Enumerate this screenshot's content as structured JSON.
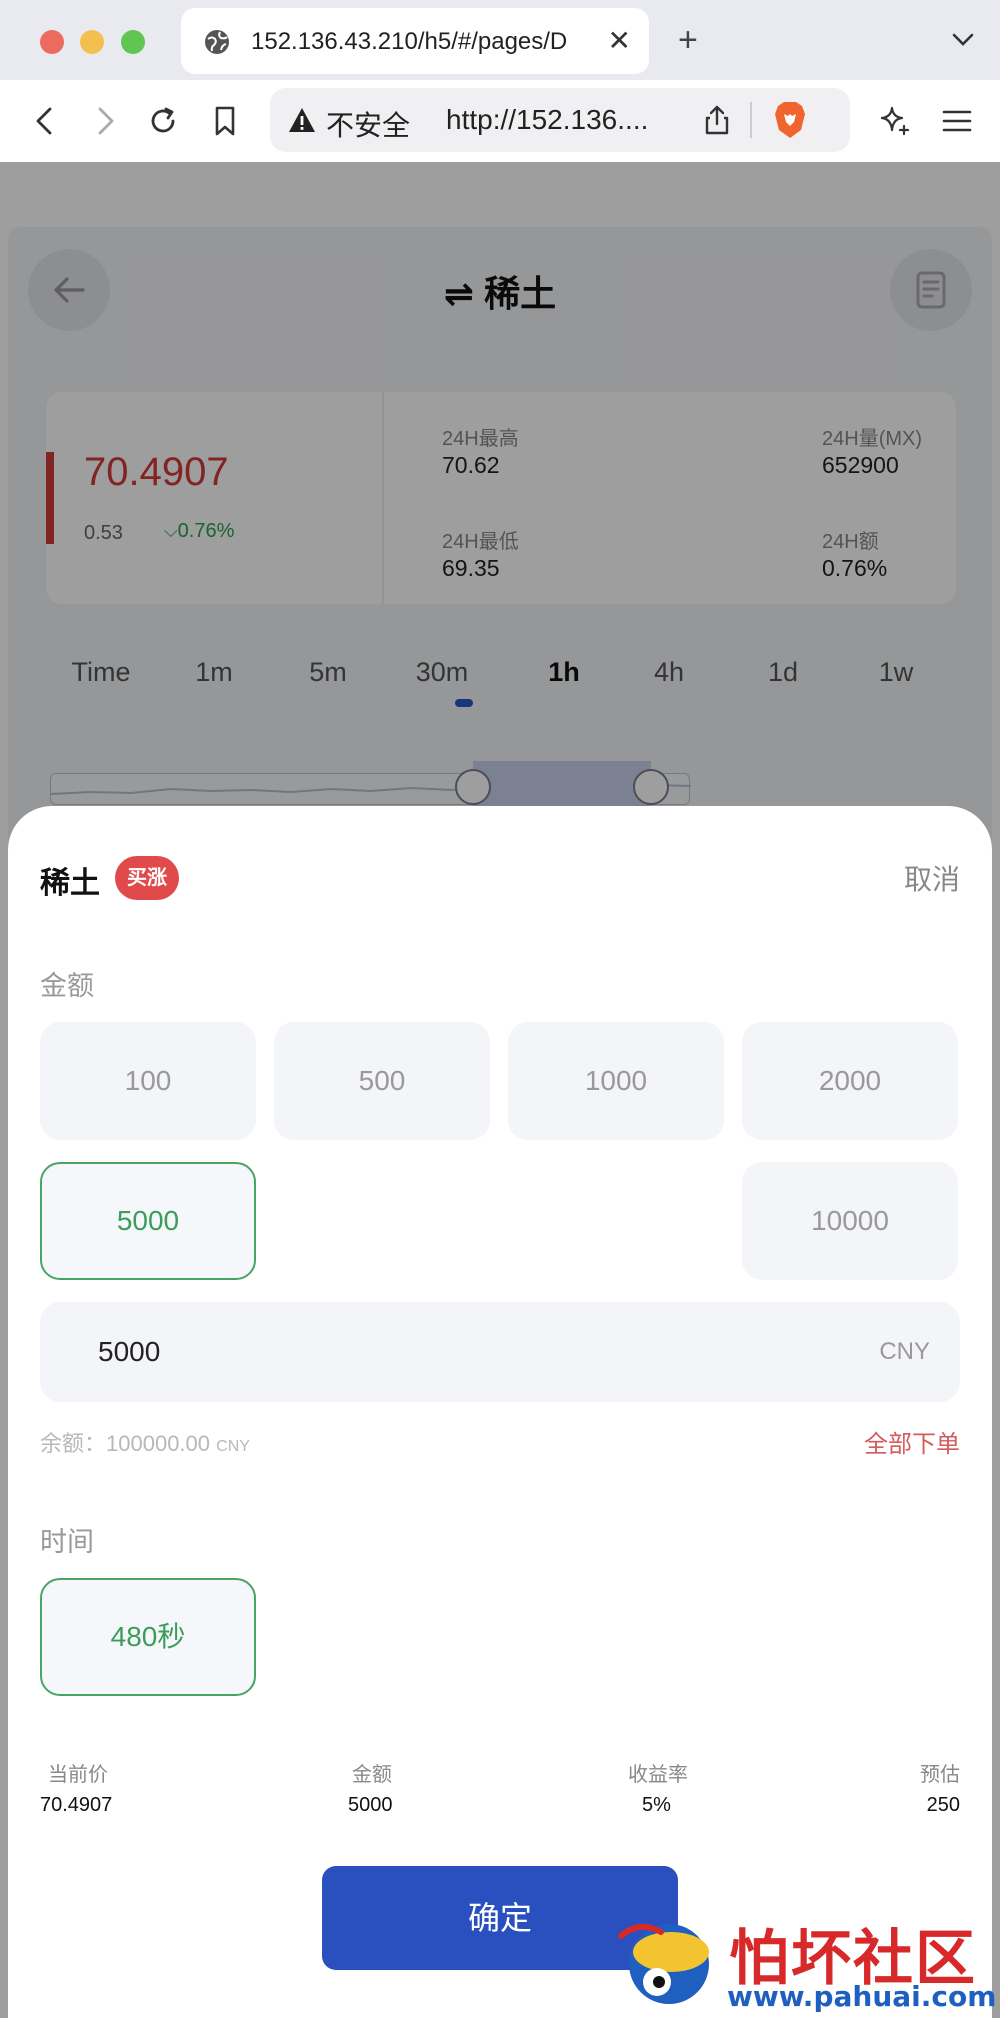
{
  "browser": {
    "tab_title": "152.136.43.210/h5/#/pages/D",
    "security_label": "不安全",
    "url_display": "http://152.136...."
  },
  "page": {
    "title": "⇌ 稀土",
    "price": "70.4907",
    "change_abs": "0.53",
    "change_pct": "0.76%",
    "stats": [
      {
        "label": "24H最高",
        "value": "70.62"
      },
      {
        "label": "24H量(MX)",
        "value": "652900"
      },
      {
        "label": "24H最低",
        "value": "69.35"
      },
      {
        "label": "24H额",
        "value": "0.76%"
      }
    ],
    "timeframes": [
      "Time",
      "1m",
      "5m",
      "30m",
      "1h",
      "4h",
      "1d",
      "1w"
    ],
    "active_timeframe": "1h"
  },
  "sheet": {
    "title": "稀土",
    "badge": "买涨",
    "cancel": "取消",
    "amount_label": "金额",
    "amounts": [
      "100",
      "500",
      "1000",
      "2000",
      "5000",
      "10000"
    ],
    "selected_amount": "5000",
    "input_value": "5000",
    "input_unit": "CNY",
    "balance_label": "余额：",
    "balance_value": "100000.00",
    "balance_unit": "CNY",
    "all_order": "全部下单",
    "time_label": "时间",
    "time_option": "480秒",
    "summary": [
      {
        "label": "当前价",
        "value": "70.4907"
      },
      {
        "label": "金额",
        "value": "5000"
      },
      {
        "label": "收益率",
        "value": "5%"
      },
      {
        "label": "预估",
        "value": "250"
      }
    ],
    "confirm": "确定"
  },
  "watermark": {
    "text": "怕坏社区",
    "url": "www.pahuai.com"
  },
  "colors": {
    "price_red": "#d23a3a",
    "up_green": "#2e9d4e",
    "selected_green": "#4aa468",
    "confirm_blue": "#2a4fbf"
  }
}
